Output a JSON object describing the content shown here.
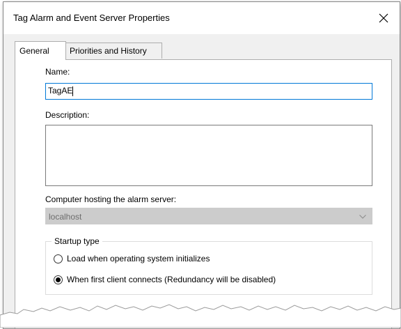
{
  "window": {
    "title": "Tag Alarm and Event Server Properties",
    "close_glyph": "✕"
  },
  "tabs": [
    {
      "label": "General",
      "active": true
    },
    {
      "label": "Priorities and History",
      "active": false
    }
  ],
  "general": {
    "name_label": "Name:",
    "name_value": "TagAE",
    "description_label": "Description:",
    "description_value": "",
    "computer_label": "Computer hosting the alarm server:",
    "computer_value": "localhost",
    "startup": {
      "title": "Startup type",
      "options": [
        {
          "label": "Load when operating system initializes",
          "selected": false
        },
        {
          "label": "When first client connects (Redundancy will be disabled)",
          "selected": true
        }
      ]
    }
  },
  "colors": {
    "focus_border": "#0078d7",
    "disabled_fill": "#cccccc"
  }
}
